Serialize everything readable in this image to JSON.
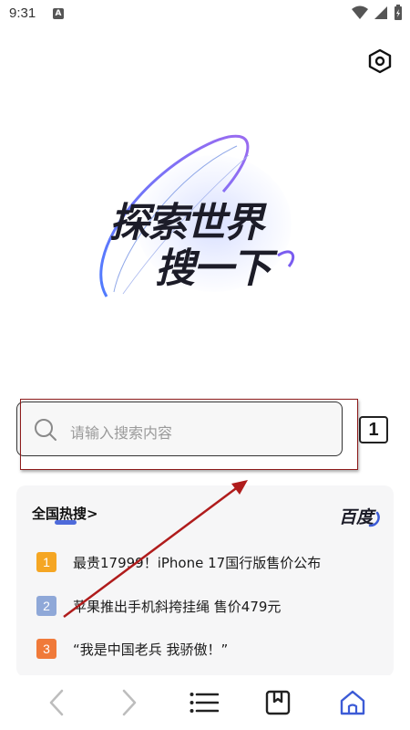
{
  "status": {
    "time": "9:31",
    "a_badge": "A"
  },
  "hero": {
    "line1": "探索世界",
    "line2": "搜一下"
  },
  "search": {
    "placeholder": "请输入搜索内容"
  },
  "annotation": {
    "step": "1"
  },
  "hot": {
    "title": "全国热搜>",
    "provider": "百度",
    "items": [
      {
        "rank": "1",
        "text": "最贵17999！iPhone 17国行版售价公布",
        "color": "#f5a623"
      },
      {
        "rank": "2",
        "text": "苹果推出手机斜挎挂绳 售价479元",
        "color": "#8fa8d8"
      },
      {
        "rank": "3",
        "text": "“我是中国老兵 我骄傲！”",
        "color": "#f07a3a"
      }
    ]
  },
  "nav": {
    "icons": [
      "back-icon",
      "forward-icon",
      "menu-icon",
      "bookmark-icon",
      "home-icon"
    ],
    "active_color": "#3c5bd6",
    "inactive_color": "#b8b8b8"
  }
}
